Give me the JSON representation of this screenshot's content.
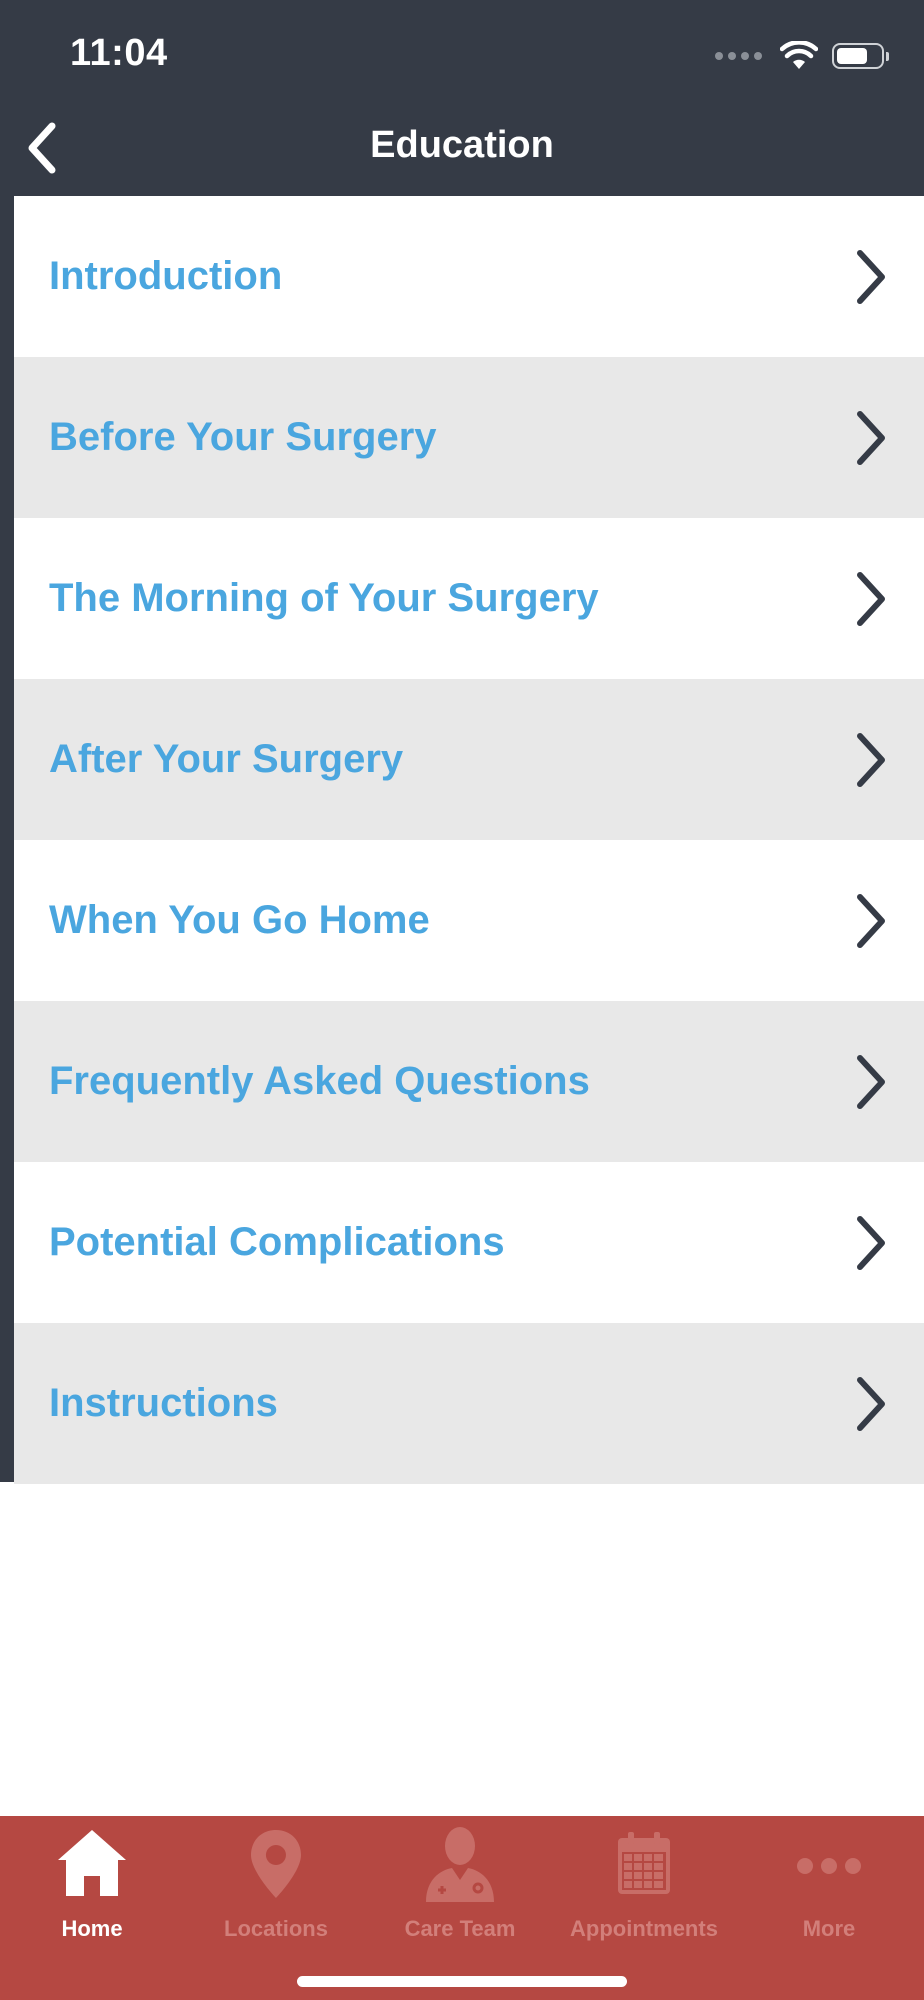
{
  "status_bar": {
    "time": "11:04",
    "battery_level": 0.72
  },
  "header": {
    "title": "Education",
    "back_icon": "chevron-left-icon"
  },
  "colors": {
    "header_bg": "#353b46",
    "link_text": "#4aa6df",
    "row_alt_bg": "#e8e8e8",
    "tabbar_bg": "#b54842",
    "tab_inactive": "#d27f7a"
  },
  "education_list": [
    {
      "label": "Introduction"
    },
    {
      "label": "Before Your Surgery"
    },
    {
      "label": "The Morning of Your Surgery"
    },
    {
      "label": "After Your Surgery"
    },
    {
      "label": "When You Go Home"
    },
    {
      "label": "Frequently Asked Questions"
    },
    {
      "label": "Potential Complications"
    },
    {
      "label": "Instructions"
    }
  ],
  "tabbar": {
    "tabs": [
      {
        "label": "Home",
        "icon": "home-icon",
        "active": true
      },
      {
        "label": "Locations",
        "icon": "map-pin-icon",
        "active": false
      },
      {
        "label": "Care Team",
        "icon": "doctor-icon",
        "active": false
      },
      {
        "label": "Appointments",
        "icon": "calendar-icon",
        "active": false
      },
      {
        "label": "More",
        "icon": "more-dots-icon",
        "active": false
      }
    ]
  }
}
